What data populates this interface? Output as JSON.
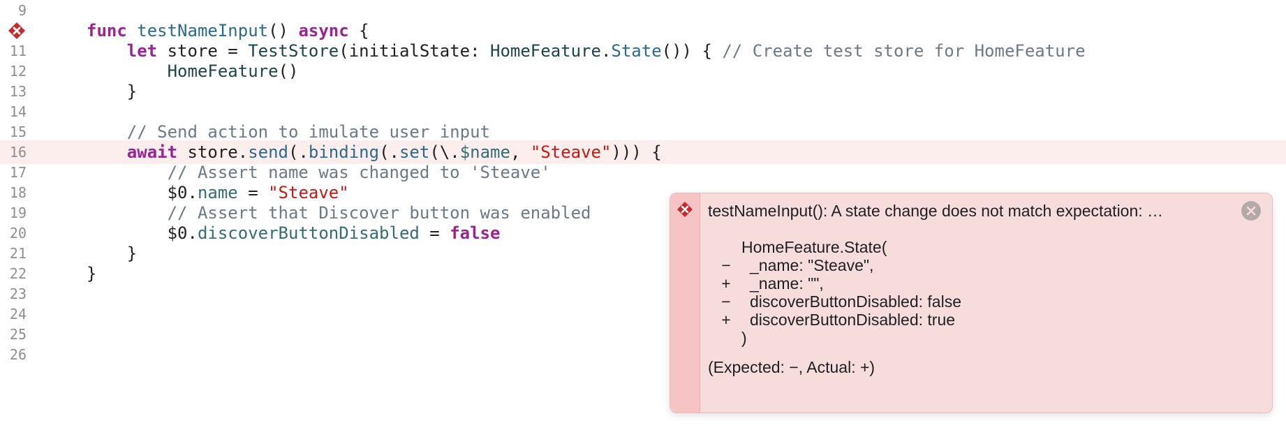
{
  "editor": {
    "lines": [
      {
        "num": "9",
        "tokens": []
      },
      {
        "num": "",
        "error": true,
        "tokens": [
          {
            "t": "kw",
            "v": "func"
          },
          {
            "t": "pl",
            "v": " "
          },
          {
            "t": "fn",
            "v": "testNameInput"
          },
          {
            "t": "pl",
            "v": "() "
          },
          {
            "t": "kw",
            "v": "async"
          },
          {
            "t": "pl",
            "v": " {"
          }
        ]
      },
      {
        "num": "11",
        "tokens": [
          {
            "t": "pl",
            "v": "    "
          },
          {
            "t": "kw",
            "v": "let"
          },
          {
            "t": "pl",
            "v": " store = "
          },
          {
            "t": "ty",
            "v": "TestStore"
          },
          {
            "t": "pl",
            "v": "(initialState: "
          },
          {
            "t": "ty",
            "v": "HomeFeature"
          },
          {
            "t": "pl",
            "v": "."
          },
          {
            "t": "fn",
            "v": "State"
          },
          {
            "t": "pl",
            "v": "()) { "
          },
          {
            "t": "cm",
            "v": "// Create test store for HomeFeature"
          }
        ]
      },
      {
        "num": "12",
        "tokens": [
          {
            "t": "pl",
            "v": "        "
          },
          {
            "t": "ty",
            "v": "HomeFeature"
          },
          {
            "t": "pl",
            "v": "()"
          }
        ]
      },
      {
        "num": "13",
        "tokens": [
          {
            "t": "pl",
            "v": "    }"
          }
        ]
      },
      {
        "num": "14",
        "tokens": []
      },
      {
        "num": "15",
        "tokens": [
          {
            "t": "pl",
            "v": "    "
          },
          {
            "t": "cm",
            "v": "// Send action to imulate user input"
          }
        ]
      },
      {
        "num": "16",
        "highlight": true,
        "tokens": [
          {
            "t": "pl",
            "v": "    "
          },
          {
            "t": "kw",
            "v": "await"
          },
          {
            "t": "pl",
            "v": " store."
          },
          {
            "t": "fn",
            "v": "send"
          },
          {
            "t": "pl",
            "v": "(."
          },
          {
            "t": "fn",
            "v": "binding"
          },
          {
            "t": "pl",
            "v": "(."
          },
          {
            "t": "fn",
            "v": "set"
          },
          {
            "t": "pl",
            "v": "(\\."
          },
          {
            "t": "mb",
            "v": "$name"
          },
          {
            "t": "pl",
            "v": ", "
          },
          {
            "t": "str",
            "v": "\"Steave\""
          },
          {
            "t": "pl",
            "v": "))) {"
          }
        ]
      },
      {
        "num": "17",
        "tokens": [
          {
            "t": "pl",
            "v": "        "
          },
          {
            "t": "cm",
            "v": "// Assert name was changed to 'Steave'"
          }
        ]
      },
      {
        "num": "18",
        "tokens": [
          {
            "t": "pl",
            "v": "        $0."
          },
          {
            "t": "mb",
            "v": "name"
          },
          {
            "t": "pl",
            "v": " = "
          },
          {
            "t": "str",
            "v": "\"Steave\""
          }
        ]
      },
      {
        "num": "19",
        "tokens": [
          {
            "t": "pl",
            "v": "        "
          },
          {
            "t": "cm",
            "v": "// Assert that Discover button was enabled"
          }
        ]
      },
      {
        "num": "20",
        "tokens": [
          {
            "t": "pl",
            "v": "        $0."
          },
          {
            "t": "mb",
            "v": "discoverButtonDisabled"
          },
          {
            "t": "pl",
            "v": " = "
          },
          {
            "t": "bl",
            "v": "false"
          }
        ]
      },
      {
        "num": "21",
        "tokens": [
          {
            "t": "pl",
            "v": "    }"
          }
        ]
      },
      {
        "num": "22",
        "tokens": [
          {
            "t": "pl",
            "v": "}"
          }
        ]
      },
      {
        "num": "23",
        "tokens": []
      },
      {
        "num": "24",
        "tokens": []
      },
      {
        "num": "25",
        "tokens": []
      },
      {
        "num": "26",
        "tokens": []
      }
    ]
  },
  "error_popover": {
    "headline": "testNameInput(): A state change does not match expectation: …",
    "diff": [
      {
        "mark": "",
        "text": "HomeFeature.State("
      },
      {
        "mark": "−",
        "text": "_name: \"Steave\","
      },
      {
        "mark": "+",
        "text": "_name: \"\","
      },
      {
        "mark": "−",
        "text": "discoverButtonDisabled: false"
      },
      {
        "mark": "+",
        "text": "discoverButtonDisabled: true"
      },
      {
        "mark": "",
        "text": ")"
      }
    ],
    "footer": "(Expected: −, Actual: +)"
  },
  "colors": {
    "error_red": "#c9282d",
    "highlight_line": "#fdeeee",
    "popover_bg": "#f6dcdb"
  },
  "icons": {
    "gutter": "error-icon",
    "popover": "error-icon",
    "close": "close-icon"
  }
}
